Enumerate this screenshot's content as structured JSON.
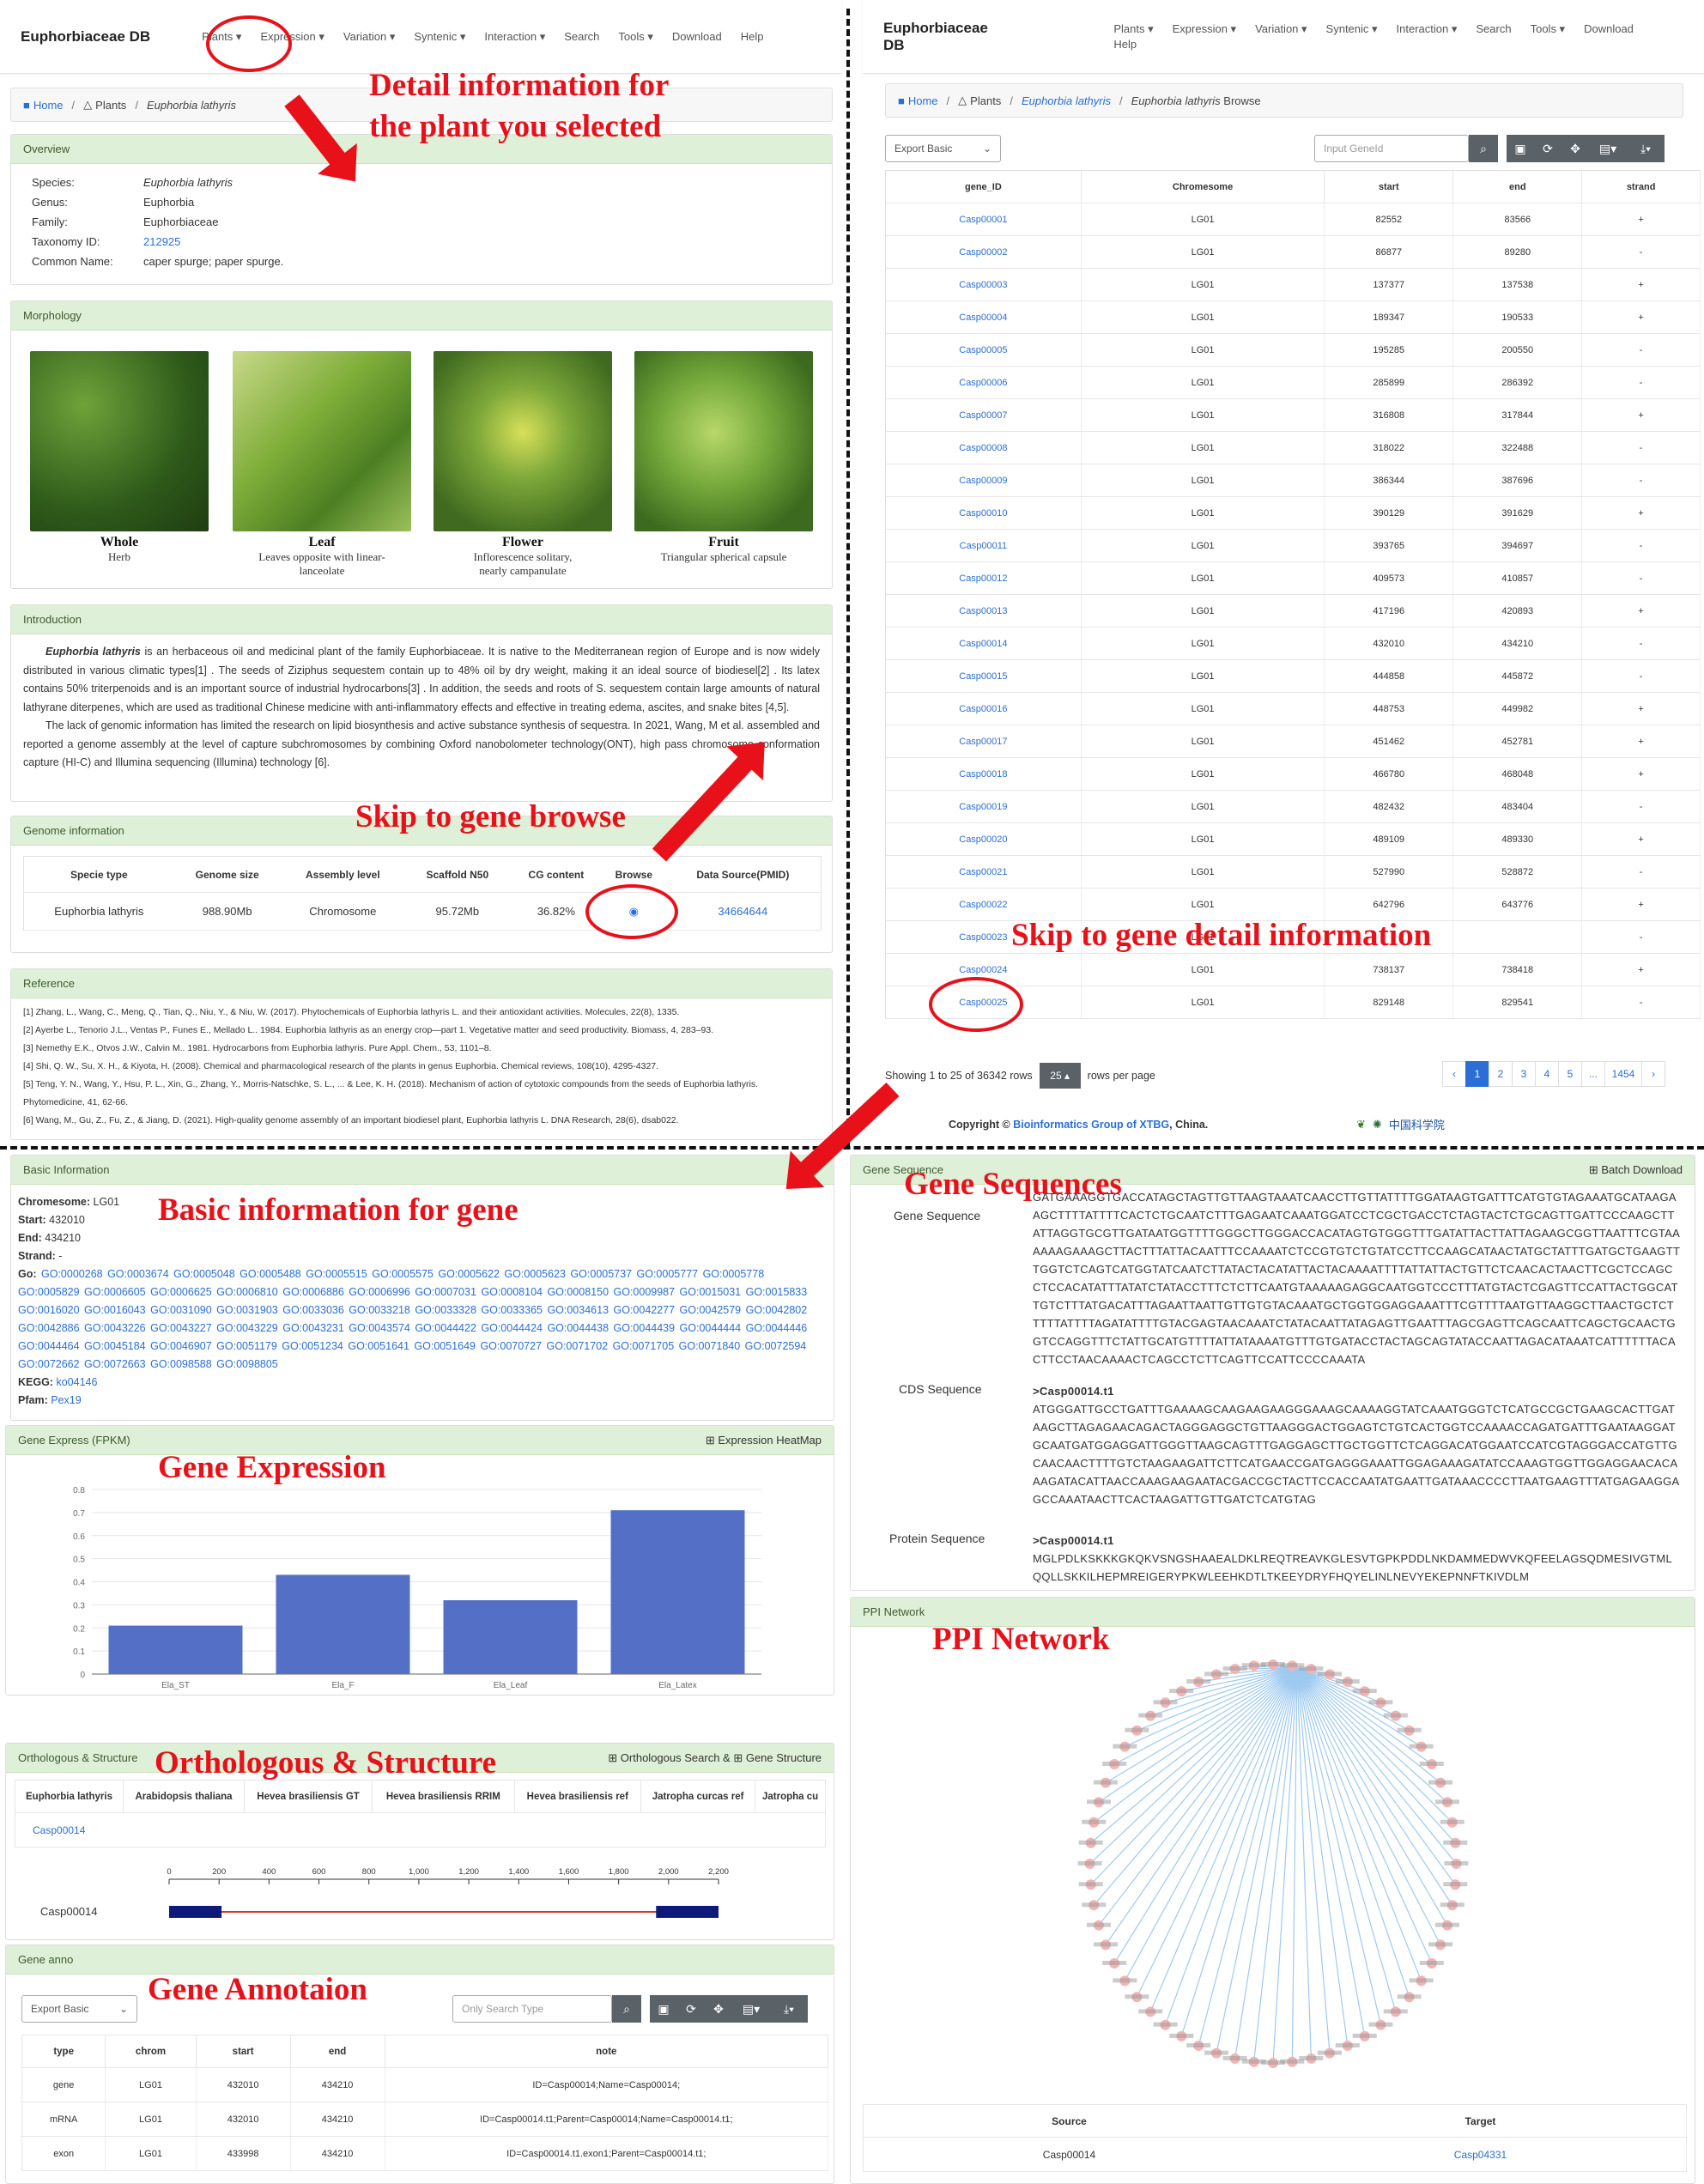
{
  "brand": "Euphorbiaceae DB",
  "nav": [
    "Plants ▾",
    "Expression ▾",
    "Variation ▾",
    "Syntenic ▾",
    "Interaction ▾",
    "Search",
    "Tools ▾",
    "Download",
    "Help"
  ],
  "bc_left": {
    "home": "Home",
    "plants": "Plants",
    "species": "Euphorbia lathyris"
  },
  "bc_right": {
    "home": "Home",
    "plants": "Plants",
    "species": "Euphorbia lathyris",
    "page": "Euphorbia lathyris Browse"
  },
  "overview": {
    "title": "Overview",
    "rows": [
      [
        "Species:",
        "Euphorbia lathyris"
      ],
      [
        "Genus:",
        "Euphorbia"
      ],
      [
        "Family:",
        "Euphorbiaceae"
      ],
      [
        "Taxonomy ID:",
        "212925"
      ],
      [
        "Common Name:",
        "caper spurge; paper spurge."
      ]
    ]
  },
  "morphology": {
    "title": "Morphology",
    "items": [
      {
        "t": "Whole",
        "d": "Herb"
      },
      {
        "t": "Leaf",
        "d": "Leaves opposite with linear-lanceolate"
      },
      {
        "t": "Flower",
        "d": "Inflorescence solitary, nearly campanulate"
      },
      {
        "t": "Fruit",
        "d": "Triangular spherical capsule"
      }
    ]
  },
  "intro": {
    "title": "Introduction",
    "p1_b": "Euphorbia lathyris",
    "p1": " is an herbaceous oil and medicinal plant of the family Euphorbiaceae. It is native to the Mediterranean region of Europe and is now widely distributed in various climatic types[1] . The seeds of Ziziphus sequestem contain up to 48% oil by dry weight, making it an ideal source of biodiesel[2] . Its latex contains 50% triterpenoids and is an important source of industrial hydrocarbons[3] . In addition, the seeds and roots of S. sequestem contain large amounts of natural lathyrane diterpenes, which are used as traditional Chinese medicine with anti-inflammatory effects and effective in treating edema, ascites, and snake bites [4,5].",
    "p2": "The lack of genomic information has limited the research on lipid biosynthesis and active substance synthesis of sequestra. In 2021, Wang, M et al. assembled and reported a genome assembly at the level of capture subchromosomes by combining Oxford nanobolometer technology(ONT), high pass chromosome conformation capture (HI-C) and Illumina sequencing (Illumina) technology [6]."
  },
  "genome": {
    "title": "Genome information",
    "headers": [
      "Specie type",
      "Genome size",
      "Assembly level",
      "Scaffold N50",
      "CG content",
      "Browse",
      "Data Source(PMID)"
    ],
    "row": [
      "Euphorbia lathyris",
      "988.90Mb",
      "Chromosome",
      "95.72Mb",
      "36.82%",
      "",
      "34664644"
    ]
  },
  "reference": {
    "title": "Reference",
    "items": [
      "[1] Zhang, L., Wang, C., Meng, Q., Tian, Q., Niu, Y., & Niu, W. (2017). Phytochemicals of Euphorbia lathyris L. and their antioxidant activities. Molecules, 22(8), 1335.",
      "[2] Ayerbe L., Tenorio J.L., Ventas P., Funes E., Mellado L.. 1984. Euphorbia lathyris as an energy crop—part 1. Vegetative matter and seed productivity. Biomass, 4, 283–93.",
      "[3] Nemethy E.K., Otvos J.W., Calvin M.. 1981. Hydrocarbons from Euphorbia lathyris. Pure Appl. Chem., 53, 1101–8.",
      "[4] Shi, Q. W., Su, X. H., & Kiyota, H. (2008). Chemical and pharmacological research of the plants in genus Euphorbia. Chemical reviews, 108(10), 4295-4327.",
      "[5] Teng, Y. N., Wang, Y., Hsu, P. L., Xin, G., Zhang, Y., Morris-Natschke, S. L., ... & Lee, K. H. (2018). Mechanism of action of cytotoxic compounds from the seeds of Euphorbia lathyris. Phytomedicine, 41, 62-66.",
      "[6] Wang, M., Gu, Z., Fu, Z., & Jiang, D. (2021). High-quality genome assembly of an important biodiesel plant, Euphorbia lathyris L. DNA Research, 28(6), dsab022."
    ]
  },
  "browse": {
    "export": "Export Basic",
    "search_ph": "Input GeneId",
    "headers": [
      "gene_ID",
      "Chromesome",
      "start",
      "end",
      "strand"
    ],
    "rows": [
      [
        "Casp00001",
        "LG01",
        "82552",
        "83566",
        "+"
      ],
      [
        "Casp00002",
        "LG01",
        "86877",
        "89280",
        "-"
      ],
      [
        "Casp00003",
        "LG01",
        "137377",
        "137538",
        "+"
      ],
      [
        "Casp00004",
        "LG01",
        "189347",
        "190533",
        "+"
      ],
      [
        "Casp00005",
        "LG01",
        "195285",
        "200550",
        "-"
      ],
      [
        "Casp00006",
        "LG01",
        "285899",
        "286392",
        "-"
      ],
      [
        "Casp00007",
        "LG01",
        "316808",
        "317844",
        "+"
      ],
      [
        "Casp00008",
        "LG01",
        "318022",
        "322488",
        "-"
      ],
      [
        "Casp00009",
        "LG01",
        "386344",
        "387696",
        "-"
      ],
      [
        "Casp00010",
        "LG01",
        "390129",
        "391629",
        "+"
      ],
      [
        "Casp00011",
        "LG01",
        "393765",
        "394697",
        "-"
      ],
      [
        "Casp00012",
        "LG01",
        "409573",
        "410857",
        "-"
      ],
      [
        "Casp00013",
        "LG01",
        "417196",
        "420893",
        "+"
      ],
      [
        "Casp00014",
        "LG01",
        "432010",
        "434210",
        "-"
      ],
      [
        "Casp00015",
        "LG01",
        "444858",
        "445872",
        "-"
      ],
      [
        "Casp00016",
        "LG01",
        "448753",
        "449982",
        "+"
      ],
      [
        "Casp00017",
        "LG01",
        "451462",
        "452781",
        "+"
      ],
      [
        "Casp00018",
        "LG01",
        "466780",
        "468048",
        "+"
      ],
      [
        "Casp00019",
        "LG01",
        "482432",
        "483404",
        "-"
      ],
      [
        "Casp00020",
        "LG01",
        "489109",
        "489330",
        "+"
      ],
      [
        "Casp00021",
        "LG01",
        "527990",
        "528872",
        "-"
      ],
      [
        "Casp00022",
        "LG01",
        "642796",
        "643776",
        "+"
      ],
      [
        "Casp00023",
        "LG01",
        "",
        "",
        "-"
      ],
      [
        "Casp00024",
        "LG01",
        "738137",
        "738418",
        "+"
      ],
      [
        "Casp00025",
        "LG01",
        "829148",
        "829541",
        "-"
      ]
    ],
    "showing": "Showing 1 to 25 of 36342 rows",
    "per": "25 ▴",
    "per_suffix": "rows per page",
    "pages": [
      "‹",
      "1",
      "2",
      "3",
      "4",
      "5",
      "...",
      "1454",
      "›"
    ]
  },
  "copyright": {
    "pre": "Copyright © ",
    "lk": "Bioinformatics Group of XTBG",
    "post": ", China.",
    "logo": "中国科学院"
  },
  "basic": {
    "title": "Basic Information",
    "chrom": [
      "Chromesome:",
      "LG01"
    ],
    "start": [
      "Start:",
      "432010"
    ],
    "end": [
      "End:",
      "434210"
    ],
    "strand": [
      "Strand:",
      "-"
    ],
    "go_label": "Go:",
    "go": "GO:0000268 GO:0003674 GO:0005048 GO:0005488 GO:0005515 GO:0005575 GO:0005622 GO:0005623 GO:0005737 GO:0005777 GO:0005778 GO:0005829 GO:0006605 GO:0006625 GO:0006810 GO:0006886 GO:0006996 GO:0007031 GO:0008104 GO:0008150 GO:0009987 GO:0015031 GO:0015833 GO:0016020 GO:0016043 GO:0031090 GO:0031903 GO:0033036 GO:0033218 GO:0033328 GO:0033365 GO:0034613 GO:0042277 GO:0042579 GO:0042802 GO:0042886 GO:0043226 GO:0043227 GO:0043229 GO:0043231 GO:0043574 GO:0044422 GO:0044424 GO:0044438 GO:0044439 GO:0044444 GO:0044446 GO:0044464 GO:0045184 GO:0046907 GO:0051179 GO:0051234 GO:0051641 GO:0051649 GO:0070727 GO:0071702 GO:0071705 GO:0071840 GO:0072594 GO:0072662 GO:0072663 GO:0098588 GO:0098805",
    "kegg": [
      "KEGG:",
      "ko04146"
    ],
    "pfam": [
      "Pfam:",
      "Pex19"
    ]
  },
  "expr": {
    "title": "Gene Express (FPKM)",
    "tool": "Expression HeatMap"
  },
  "chart_data": {
    "type": "bar",
    "categories": [
      "Ela_ST",
      "Ela_F",
      "Ela_Leaf",
      "Ela_Latex"
    ],
    "values": [
      0.21,
      0.43,
      0.32,
      0.71
    ],
    "ylim": [
      0,
      0.8
    ],
    "yticks": [
      0,
      0.1,
      0.2,
      0.3,
      0.4,
      0.5,
      0.6,
      0.7,
      0.8
    ],
    "color": "#5470c6",
    "grid": true
  },
  "ortho": {
    "title": "Orthologous & Structure",
    "tool": "Orthologous Search & ",
    "tool2": "Gene Structure",
    "headers": [
      "Euphorbia lathyris",
      "Arabidopsis thaliana",
      "Hevea brasiliensis GT",
      "Hevea brasiliensis RRIM",
      "Hevea brasiliensis ref",
      "Jatropha curcas ref",
      "Jatropha cu"
    ],
    "gene": "Casp00014",
    "ticks": [
      "0",
      "200",
      "400",
      "600",
      "800",
      "1,000",
      "1,200",
      "1,400",
      "1,600",
      "1,800",
      "2,000",
      "2,200"
    ],
    "exons": [
      [
        0,
        210
      ],
      [
        1950,
        2200
      ]
    ],
    "len": 2200
  },
  "anno": {
    "title": "Gene anno",
    "export": "Export Basic",
    "search_ph": "Only Search Type",
    "headers": [
      "type",
      "chrom",
      "start",
      "end",
      "note"
    ],
    "rows": [
      [
        "gene",
        "LG01",
        "432010",
        "434210",
        "ID=Casp00014;Name=Casp00014;"
      ],
      [
        "mRNA",
        "LG01",
        "432010",
        "434210",
        "ID=Casp00014.t1;Parent=Casp00014;Name=Casp00014.t1;"
      ],
      [
        "exon",
        "LG01",
        "433998",
        "434210",
        "ID=Casp00014.t1.exon1;Parent=Casp00014.t1;"
      ]
    ]
  },
  "seq": {
    "title": "Gene Sequence",
    "tool": "Batch Download",
    "gene_label": "Gene Sequence",
    "cds_label": "CDS Sequence",
    "prot_label": "Protein Sequence",
    "gene": "GATGAAAGGTGACCATAGCTAGTTGTTAAGTAAATCAACCTTGTTATTTTGGATAAGTGATTTCATGTGTAGAAATGCATAAGAAGCTTTTATTTTCACTCTGCAATCTTTGAGAATCAAATGGATCCTCGCTGACCTCTAGTACTCTGCAGTTGATTCCCAAGCTTATTAGGTGCGTTGATAATGGTTTTGGGCTTGGGACCACATAGTGTGGGTTTGATATTACTTATTAGAAGCGGTTAATTTCGTAAAAAAGAAAGCTTACTTTATTACAATTTCCAAAATCTCCGTGTCTGTATCCTTCCAAGCATAACTATGCTATTTGATGCTGAAGTTTGGTCTCAGTCATGGTATCAATCTTATACTACATATTACTACAAAATTTTATTATTACTGTTCTCAACACTAACTTCGCTCCAGCCTCCACATATTTATATCTATACCTTTCTCTTCAATGTAAAAAGAGGCAATGGTCCCTTTATGTACTCGAGTTCCATTACTGGCATTGTCTTTATGACATTTAGAATTAATTGTTGTGTACAAATGCTGGTGGAGGAAATTTCGTTTTAATGTTAAGGCTTAACTGCTCTTTTTATTTTAGATATTTTGTACGAGTAACAAATCTATACAATTATAGAGTTGAATTTAGCGAGTTCAGCAATTCAGCTGCAACTGGTCCAGGTTTCTATTGCATGTTTTATTATAAAATGTTTGTGATACCTACTAGCAGTATACCAATTAGACATAAATCATTTTTTACACTTCCTAACAAAACTCAGCCTCTTCAGTTCCATTCCCCAAATA",
    "cds_h": ">Casp00014.t1",
    "cds": "ATGGGATTGCCTGATTTGAAAAGCAAGAAGAAGGGAAAGCAAAAGGTATCAAATGGGTCTCATGCCGCTGAAGCACTTGATAAGCTTAGAGAACAGACTAGGGAGGCTGTTAAGGGACTGGAGTCTGTCACTGGTCCAAAACCAGATGATTTGAATAAGGATGCAATGATGGAGGATTGGGTTAAGCAGTTTGAGGAGCTTGCTGGTTCTCAGGACATGGAATCCATCGTAGGGACCATGTTGCAACAACTTTTGTCTAAGAAGATTCTTCATGAACCGATGAGGGAAATTGGAGAAAGATATCCAAAGTGGTTGGAGGAACACAAAGATACATTAACCAAAGAAGAATACGACCGCTACTTCCACCAATATGAATTGATAAACCCCTTAATGAAGTTTATGAGAAGGAGCCAAATAACTTCACTAAGATTGTTGATCTCATGTAG",
    "prot_h": ">Casp00014.t1",
    "prot": "MGLPDLKSKKKGKQKVSNGSHAAEALDKLREQTREAVKGLESVTGPKPDDLNKDAMMEDWVKQFEELAGSQDMESIVGTMLQQLLSKKILHEPMREIGERYPKWLEEHKDTLTKEEYDRYFHQYELINLNEVYEKEPNNFTKIVDLM"
  },
  "ppi": {
    "title": "PPI Network",
    "headers": [
      "Source",
      "Target"
    ],
    "row": [
      "Casp00014",
      "Casp04331"
    ],
    "node_count": 60
  },
  "ann": {
    "detail": "Detail information for\nthe plant you selected",
    "skip_browse": "Skip to gene browse",
    "skip_detail": "Skip to gene detail  information",
    "basic": "Basic information for gene",
    "seqs": "Gene Sequences",
    "expr": "Gene Expression",
    "ppi": "PPI Network",
    "ortho": "Orthologous & Structure",
    "anno": "Gene Annotaion"
  }
}
